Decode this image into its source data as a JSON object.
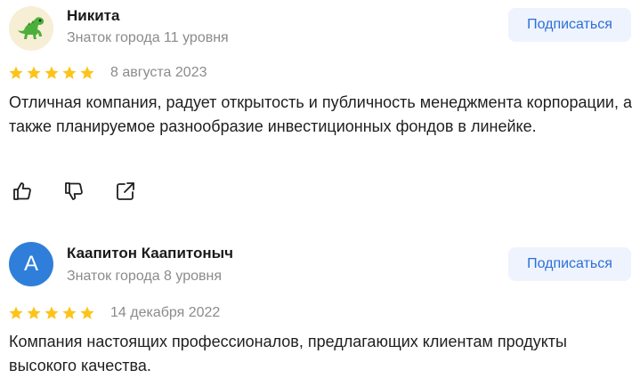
{
  "reviews": [
    {
      "name": "Никита",
      "level": "Знаток города 11 уровня",
      "subscribe_label": "Подписаться",
      "rating": 5,
      "date": "8 августа 2023",
      "text": "Отличная компания, радует открытость и публичность менеджмента корпорации, а также планируемое разнообразие инвестиционных фондов в линейке.",
      "avatar_icon": "dinosaur-icon"
    },
    {
      "name": "Каапитон Каапитоныч",
      "level": "Знаток города 8 уровня",
      "subscribe_label": "Подписаться",
      "rating": 5,
      "date": "14 декабря 2022",
      "text": "Компания настоящих профессионалов, предлагающих клиентам продукты высокого качества.",
      "avatar_letter": "А"
    }
  ],
  "colors": {
    "star": "#fcc419",
    "subscribe_bg": "#eef3fd",
    "subscribe_text": "#2d6fd8",
    "avatar_letter_bg": "#2f7fda"
  },
  "icons": [
    "like-icon",
    "dislike-icon",
    "share-icon",
    "star-icon"
  ]
}
